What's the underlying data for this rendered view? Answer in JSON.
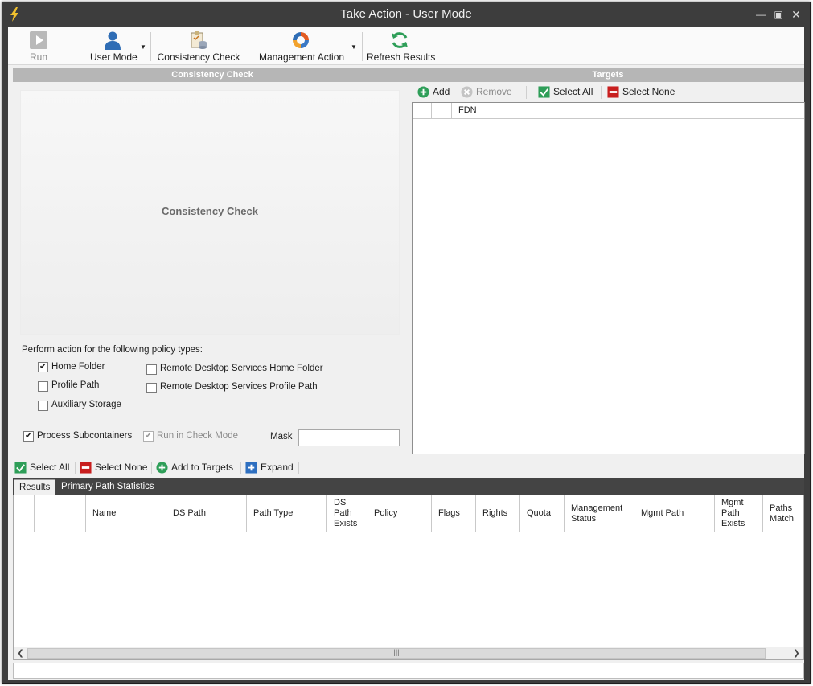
{
  "window": {
    "title": "Take Action - User Mode"
  },
  "toolbar": {
    "run": "Run",
    "user_mode": "User Mode",
    "consistency_check": "Consistency Check",
    "management_action": "Management Action",
    "refresh_results": "Refresh Results"
  },
  "left_panel": {
    "header": "Consistency Check",
    "placeholder": "Consistency Check",
    "policy_caption": "Perform action for the following policy types:",
    "policies": {
      "home_folder": {
        "label": "Home Folder",
        "checked": true
      },
      "profile_path": {
        "label": "Profile Path",
        "checked": false
      },
      "auxiliary_storage": {
        "label": "Auxiliary Storage",
        "checked": false
      },
      "rds_home_folder": {
        "label": "Remote Desktop Services Home Folder",
        "checked": false
      },
      "rds_profile_path": {
        "label": "Remote Desktop Services Profile Path",
        "checked": false
      }
    },
    "process_subcontainers": {
      "label": "Process Subcontainers",
      "checked": true
    },
    "run_in_check_mode": {
      "label": "Run in Check Mode",
      "checked": true,
      "disabled": true
    },
    "mask": {
      "label": "Mask",
      "value": ""
    }
  },
  "targets": {
    "header": "Targets",
    "toolbar": {
      "add": "Add",
      "remove": "Remove",
      "select_all": "Select All",
      "select_none": "Select None"
    },
    "columns": [
      "FDN"
    ]
  },
  "results_toolbar": {
    "select_all": "Select All",
    "select_none": "Select None",
    "add_to_targets": "Add to Targets",
    "expand": "Expand"
  },
  "tabs": [
    {
      "label": "Results",
      "active": true
    },
    {
      "label": "Primary Path Statistics",
      "active": false
    }
  ],
  "results_grid": {
    "columns": [
      "Name",
      "DS Path",
      "Path Type",
      "DS Path Exists",
      "Policy",
      "Flags",
      "Rights",
      "Quota",
      "Management Status",
      "Mgmt Path",
      "Mgmt Path Exists",
      "Paths Match"
    ]
  },
  "colors": {
    "title_bar": "#3d3d3d",
    "panel_header": "#b6b6b6",
    "add_green": "#2e9e58",
    "remove_red": "#c81e1e",
    "expand_blue": "#2e6fc0"
  }
}
